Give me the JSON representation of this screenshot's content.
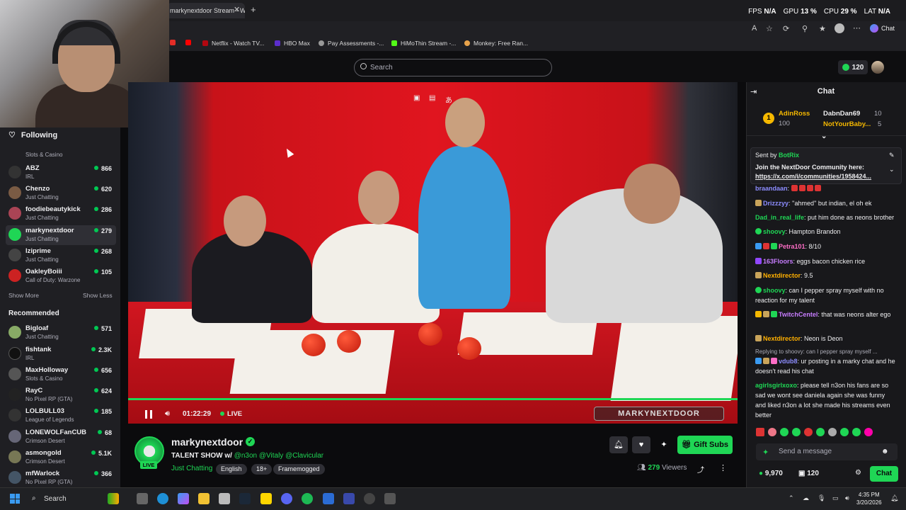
{
  "browser": {
    "tab_title": "markynextdoor Stream - Watc",
    "perf": {
      "fps_label": "FPS",
      "fps": "N/A",
      "gpu_label": "GPU",
      "gpu": "13 %",
      "cpu_label": "CPU",
      "cpu": "29 %",
      "lat_label": "LAT",
      "lat": "N/A"
    },
    "chat_button": "Chat",
    "bookmarks": [
      "Netflix - Watch TV...",
      "HBO Max",
      "Pay Assessments -...",
      "HiMoThin Stream -...",
      "Monkey: Free Ran..."
    ]
  },
  "topnav": {
    "search_placeholder": "Search",
    "bits_count": "120"
  },
  "sidebar": {
    "following_label": "Following",
    "following": [
      {
        "name": "",
        "category": "Slots & Casino",
        "viewers": ""
      },
      {
        "name": "ABZ",
        "category": "IRL",
        "viewers": "866"
      },
      {
        "name": "Chenzo",
        "category": "Just Chatting",
        "viewers": "620"
      },
      {
        "name": "foodiebeautykick",
        "category": "Just Chatting",
        "viewers": "286"
      },
      {
        "name": "markynextdoor",
        "category": "Just Chatting",
        "viewers": "279"
      },
      {
        "name": "lziprime",
        "category": "Just Chatting",
        "viewers": "268"
      },
      {
        "name": "OakleyBoiii",
        "category": "Call of Duty: Warzone",
        "viewers": "105"
      }
    ],
    "show_more": "Show More",
    "show_less": "Show Less",
    "recommended_label": "Recommended",
    "recommended": [
      {
        "name": "Bigloaf",
        "category": "Just Chatting",
        "viewers": "571"
      },
      {
        "name": "fishtank",
        "category": "IRL",
        "viewers": "2.3K"
      },
      {
        "name": "MaxHolloway",
        "category": "Slots & Casino",
        "viewers": "656"
      },
      {
        "name": "RayC",
        "category": "No Pixel RP (GTA)",
        "viewers": "624"
      },
      {
        "name": "LOLBULL03",
        "category": "League of Legends",
        "viewers": "185"
      },
      {
        "name": "LONEWOLFanCUB",
        "category": "Crimson Desert",
        "viewers": "68"
      },
      {
        "name": "asmongold",
        "category": "Crimson Desert",
        "viewers": "5.1K"
      },
      {
        "name": "mfWarlock",
        "category": "No Pixel RP (GTA)",
        "viewers": "366"
      }
    ]
  },
  "player": {
    "time": "01:22:29",
    "live_label": "LIVE",
    "watermark": "MARKYNEXTDOOR"
  },
  "channel": {
    "name": "markynextdoor",
    "live_badge": "LIVE",
    "title_prefix": "TALENT SHOW w/ ",
    "title_mentions": "@n3on @Vitaly @Clavicular",
    "category": "Just Chatting",
    "tags": [
      "English",
      "18+",
      "Framemogged"
    ],
    "gift_label": "Gift Subs",
    "viewers": "279",
    "viewers_label": "Viewers"
  },
  "chat": {
    "title": "Chat",
    "leaderboard": [
      {
        "rank": "1",
        "name": "AdinRoss",
        "value": "100"
      },
      {
        "name": "DabnDan69",
        "value": "10"
      },
      {
        "name": "NotYourBaby...",
        "value": "5"
      }
    ],
    "pinned": {
      "sent_by": "Sent by",
      "sender": "BotRix",
      "line1": "Join the NextDoor Community here:",
      "line2": "https://x.com/i/communities/1958424..."
    },
    "messages": [
      {
        "user": "braandaan",
        "text": ":",
        "color": "#8d8dff"
      },
      {
        "user": "Drizzzyy",
        "text": ": ''ahmed'' but indian, el oh ek",
        "color": "#8d8dff"
      },
      {
        "user": "Dad_in_real_life",
        "text": ": put him done as neons brother",
        "color": "#1fd655"
      },
      {
        "user": "shoovy",
        "text": ": Hampton Brandon",
        "color": "#1fd655"
      },
      {
        "user": "Petra101",
        "text": ": 8/10",
        "color": "#ff6ec7"
      },
      {
        "user": "163Floors",
        "text": ": eggs bacon chicken rice",
        "color": "#c77dff"
      },
      {
        "user": "Nextdirector",
        "text": ": 9.5",
        "color": "#ffb000"
      },
      {
        "user": "shoovy",
        "text": ": can I pepper spray myself with no reaction for my talent",
        "color": "#1fd655"
      },
      {
        "user": "TwitchCentel",
        "text": ": that was neons alter ego",
        "color": "#c77dff"
      },
      {
        "user": "Nextdirector",
        "text": ": Neon is Deon",
        "color": "#ffb000"
      },
      {
        "user": "vdub8",
        "text": ": ur posting in a marky chat and he doesn't read his chat",
        "color": "#8d8dff",
        "reply": "Replying to shoovy: can I pepper spray myself ..."
      },
      {
        "user": "agirlsgirlxoxo",
        "text": ": please tell n3on his fans are so sad we wont see daniela again she was funny and liked n3on a lot she made his streams even better",
        "color": "#1fd655"
      }
    ],
    "input_placeholder": "Send a message",
    "points": "9,970",
    "bits": "120",
    "send_label": "Chat"
  },
  "taskbar": {
    "search_label": "Search",
    "time": "4:35 PM",
    "date": "3/20/2026"
  }
}
